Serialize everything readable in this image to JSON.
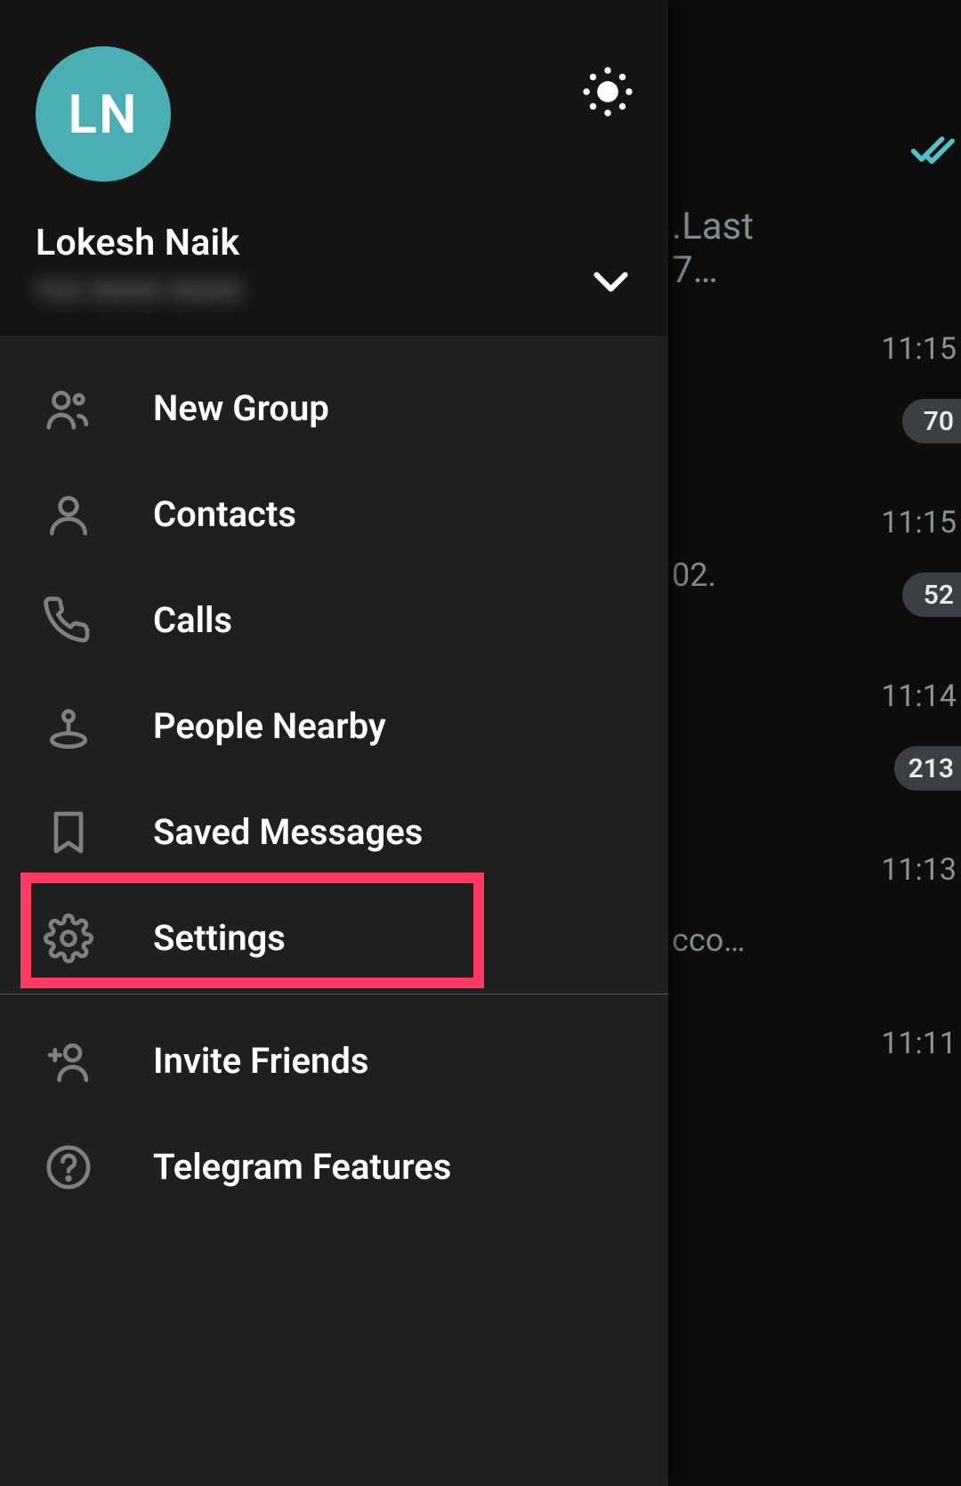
{
  "user": {
    "name": "Lokesh Naik",
    "initials": "LN",
    "phone": "+xx xxxxx xxxxx"
  },
  "menu": {
    "items": [
      {
        "label": "New Group"
      },
      {
        "label": "Contacts"
      },
      {
        "label": "Calls"
      },
      {
        "label": "People Nearby"
      },
      {
        "label": "Saved Messages"
      },
      {
        "label": "Settings"
      },
      {
        "label": "Invite Friends"
      },
      {
        "label": "Telegram Features"
      }
    ]
  },
  "chats": [
    {
      "time": "",
      "badge": "",
      "message": ".Last\n7…",
      "read": true
    },
    {
      "time": "11:15",
      "badge": "70",
      "message": ""
    },
    {
      "time": "11:15",
      "badge": "52",
      "message": "02."
    },
    {
      "time": "11:14",
      "badge": "213",
      "message": ""
    },
    {
      "time": "11:13",
      "badge": "",
      "message": "cco…"
    },
    {
      "time": "11:11",
      "badge": "",
      "message": ""
    }
  ]
}
